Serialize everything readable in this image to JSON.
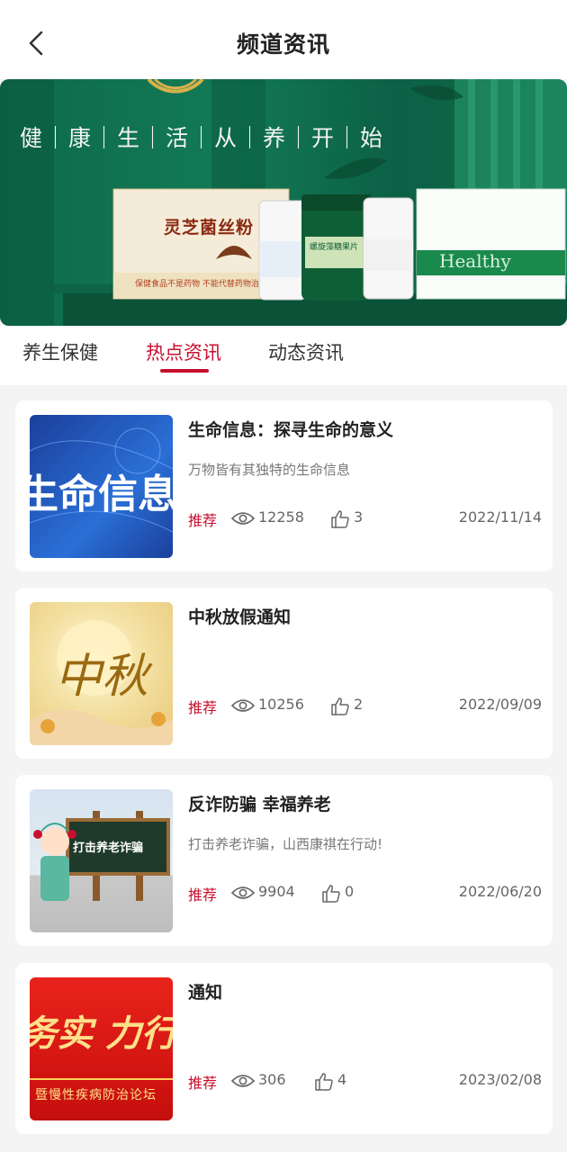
{
  "header": {
    "title": "频道资讯"
  },
  "banner": {
    "slogan": "健｜康｜生｜活｜从｜养｜开｜始",
    "product1": "灵芝菌丝粉",
    "product1_sub": "保健食品不是药物  不能代替药物治",
    "product2": "螺旋藻糖果片",
    "product3": "Healthy"
  },
  "tabs": [
    {
      "label": "养生保健"
    },
    {
      "label": "热点资讯"
    },
    {
      "label": "动态资讯"
    }
  ],
  "articles": [
    {
      "title": "生命信息：探寻生命的意义",
      "desc": "万物皆有其独特的生命信息",
      "tag": "推荐",
      "views": "12258",
      "likes": "3",
      "date": "2022/11/14",
      "thumb_text": "生命信息"
    },
    {
      "title": "中秋放假通知",
      "desc": "",
      "tag": "推荐",
      "views": "10256",
      "likes": "2",
      "date": "2022/09/09",
      "thumb_text": "中秋"
    },
    {
      "title": "反诈防骗 幸福养老",
      "desc": "打击养老诈骗，山西康祺在行动!",
      "tag": "推荐",
      "views": "9904",
      "likes": "0",
      "date": "2022/06/20",
      "thumb_text": "打击养老诈骗"
    },
    {
      "title": "通知",
      "desc": "",
      "tag": "推荐",
      "views": "306",
      "likes": "4",
      "date": "2023/02/08",
      "thumb_text": "务实 力行",
      "thumb_sub": "暨慢性疾病防治论坛"
    }
  ],
  "colors": {
    "accent": "#c8102e",
    "banner_green": "#0f6d4c"
  }
}
